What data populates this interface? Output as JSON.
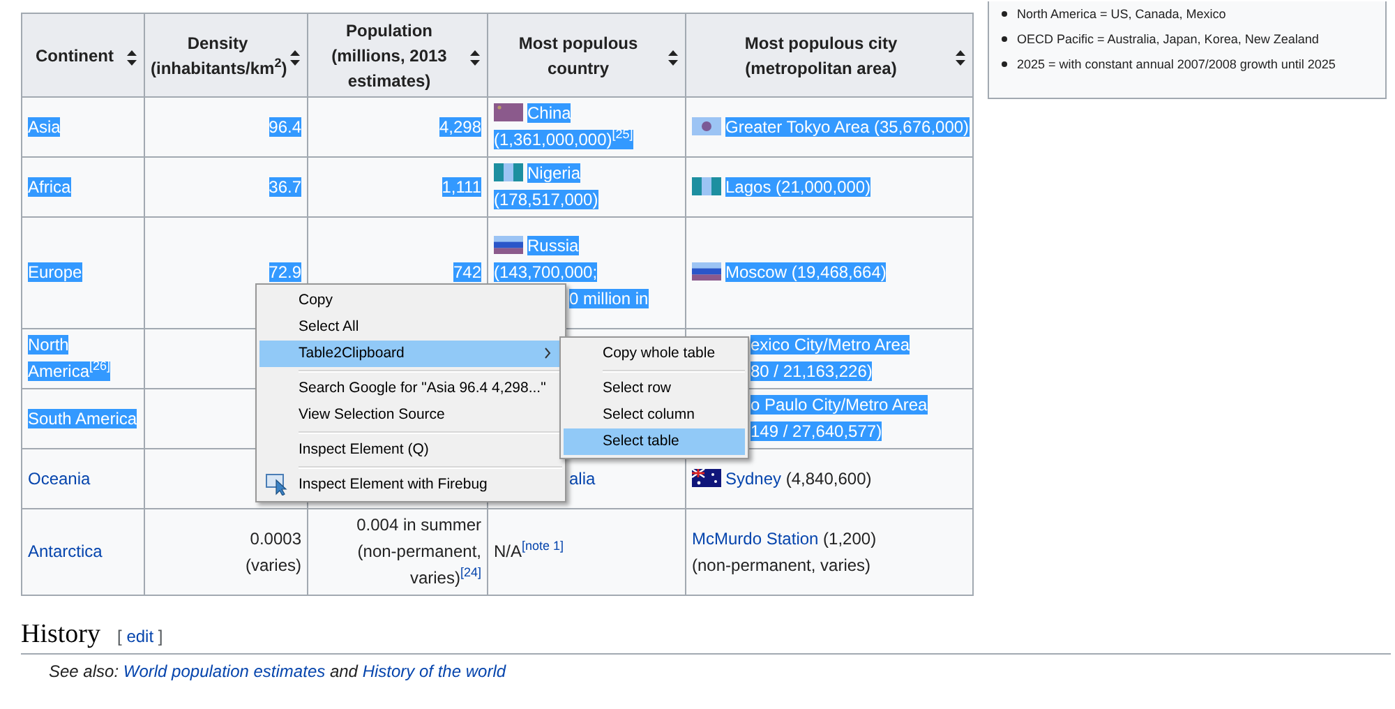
{
  "table": {
    "columns": [
      {
        "label": "Continent",
        "numeric": false
      },
      {
        "label": "Density (inhabitants/km$^{2}$)",
        "numeric": true
      },
      {
        "label": "Population (millions, 2013 estimates)",
        "numeric": true
      },
      {
        "label": "Most populous country",
        "numeric": false
      },
      {
        "label": "Most populous city (metropolitan area)",
        "numeric": false
      }
    ],
    "rows": [
      {
        "selected": true,
        "cells": [
          {
            "lines": [
              {
                "runs": [
                  "Asia"
                ]
              }
            ]
          },
          {
            "lines": [
              {
                "runs": [
                  "96.4"
                ]
              }
            ]
          },
          {
            "lines": [
              {
                "runs": [
                  "4,298"
                ]
              }
            ]
          },
          {
            "kind": "flag-china",
            "lines": [
              {
                "runs": [
                  "China"
                ]
              },
              {
                "runs": [
                  "(1,361,000,000)$^{[25]}$"
                ]
              }
            ]
          },
          {
            "kind": "flag-japan",
            "lines": [
              {
                "runs": [
                  "Greater Tokyo Area (35,676,000)"
                ]
              }
            ]
          }
        ]
      },
      {
        "selected": true,
        "cells": [
          {
            "lines": [
              {
                "runs": [
                  "Africa"
                ]
              }
            ]
          },
          {
            "lines": [
              {
                "runs": [
                  "36.7"
                ]
              }
            ]
          },
          {
            "lines": [
              {
                "runs": [
                  "1,111"
                ]
              }
            ]
          },
          {
            "kind": "flag-nigeria",
            "lines": [
              {
                "runs": [
                  "Nigeria"
                ]
              },
              {
                "runs": [
                  "(178,517,000)"
                ]
              }
            ]
          },
          {
            "kind": "flag-nigeria",
            "lines": [
              {
                "runs": [
                  "Lagos (21,000,000)"
                ]
              }
            ]
          }
        ]
      },
      {
        "selected": true,
        "cells": [
          {
            "lines": [
              {
                "runs": [
                  "Europe"
                ]
              }
            ]
          },
          {
            "lines": [
              {
                "runs": [
                  "72.9"
                ]
              }
            ]
          },
          {
            "lines": [
              {
                "runs": [
                  "742"
                ]
              }
            ]
          },
          {
            "kind": "flag-russia",
            "lines": [
              {
                "runs": [
                  "Russia"
                ]
              },
              {
                "runs": [
                  "(143,700,000;"
                ]
              },
              {
                "runs": [
                  "0 million in"
                ],
                "covered": true
              }
            ]
          },
          {
            "kind": "flag-russia",
            "lines": [
              {
                "runs": [
                  "Moscow (19,468,664)"
                ]
              }
            ]
          }
        ]
      },
      {
        "selected": true,
        "cells": [
          {
            "lines": [
              {
                "runs": [
                  "North"
                ]
              },
              {
                "runs": [
                  "America$^{[26]}$"
                ]
              }
            ]
          },
          {},
          {},
          {},
          {
            "lines": [
              {
                "runs": [
                  "exico City/Metro Area"
                ],
                "covered": true
              },
              {
                "runs": [
                  "80 / 21,163,226)"
                ],
                "covered": true
              }
            ]
          }
        ]
      },
      {
        "selected": true,
        "cells": [
          {
            "lines": [
              {
                "runs": [
                  "South America"
                ]
              }
            ]
          },
          {},
          {},
          {},
          {
            "lines": [
              {
                "runs": [
                  "o Paulo City/Metro Area"
                ],
                "covered": true
              },
              {
                "runs": [
                  "149 / 27,640,577)"
                ],
                "covered": true
              }
            ]
          }
        ]
      },
      {
        "selected": false,
        "cells": [
          {
            "lines": [
              {
                "runs": [
                  {
                    "text": "Oceania",
                    "link": true
                  }
                ]
              }
            ]
          },
          {},
          {},
          {
            "lines": [
              {
                "runs": [
                  {
                    "text": "alia",
                    "link": true
                  }
                ],
                "covered": true
              }
            ]
          },
          {
            "kind": "flag-australia",
            "lines": [
              {
                "runs": [
                  {
                    "text": "Sydney",
                    "link": true
                  },
                  " (4,840,600)"
                ]
              }
            ]
          }
        ]
      },
      {
        "selected": false,
        "cells": [
          {
            "lines": [
              {
                "runs": [
                  {
                    "text": "Antarctica",
                    "link": true
                  }
                ]
              }
            ]
          },
          {
            "lines": [
              {
                "runs": [
                  "0.0003"
                ]
              },
              {
                "runs": [
                  "(varies)"
                ]
              }
            ]
          },
          {
            "lines": [
              {
                "runs": [
                  "0.004 in summer"
                ]
              },
              {
                "runs": [
                  "(non-permanent,"
                ]
              },
              {
                "runs": [
                  "varies)",
                  {
                    "text": "$^{[24]}$",
                    "link": true
                  }
                ]
              }
            ]
          },
          {
            "lines": [
              {
                "runs": [
                  "N/A",
                  {
                    "text": "$^{[note 1]}$",
                    "link": true
                  }
                ]
              }
            ]
          },
          {
            "lines": [
              {
                "runs": [
                  {
                    "text": "McMurdo Station",
                    "link": true
                  },
                  " (1,200)"
                ]
              },
              {
                "runs": [
                  "(non-permanent, varies)"
                ]
              }
            ]
          }
        ]
      }
    ]
  },
  "side_note": {
    "items": [
      "North America = US, Canada, Mexico",
      "OECD Pacific = Australia, Japan, Korea, New Zealand",
      "2025 = with constant annual 2007/2008 growth until 2025"
    ]
  },
  "section": {
    "heading": "History",
    "edit_link": "edit",
    "edit_brackets": [
      "[",
      "]"
    ],
    "see_also_prefix": "See also:",
    "links": [
      "World population estimates",
      "History of the world"
    ],
    "joiner": "and"
  },
  "context_menu": {
    "items": [
      {
        "kind": "item",
        "label": "Copy",
        "selected": false
      },
      {
        "kind": "item",
        "label": "Select All",
        "selected": false
      },
      {
        "kind": "submenu",
        "label": "Table2Clipboard",
        "selected": true
      },
      {
        "kind": "separator"
      },
      {
        "kind": "item",
        "label": "Search Google for \"Asia 96.4 4,298...\"",
        "selected": false
      },
      {
        "kind": "item",
        "label": "View Selection Source",
        "selected": false
      },
      {
        "kind": "separator"
      },
      {
        "kind": "item",
        "label": "Inspect Element (Q)",
        "selected": false
      },
      {
        "kind": "separator"
      },
      {
        "kind": "icon-item",
        "label": "Inspect Element with Firebug",
        "selected": false
      }
    ],
    "submenu": [
      {
        "kind": "item",
        "label": "Copy whole table",
        "selected": false
      },
      {
        "kind": "separator"
      },
      {
        "kind": "item",
        "label": "Select row",
        "selected": false
      },
      {
        "kind": "item",
        "label": "Select column",
        "selected": false
      },
      {
        "kind": "item",
        "label": "Select table",
        "selected": true
      }
    ]
  }
}
